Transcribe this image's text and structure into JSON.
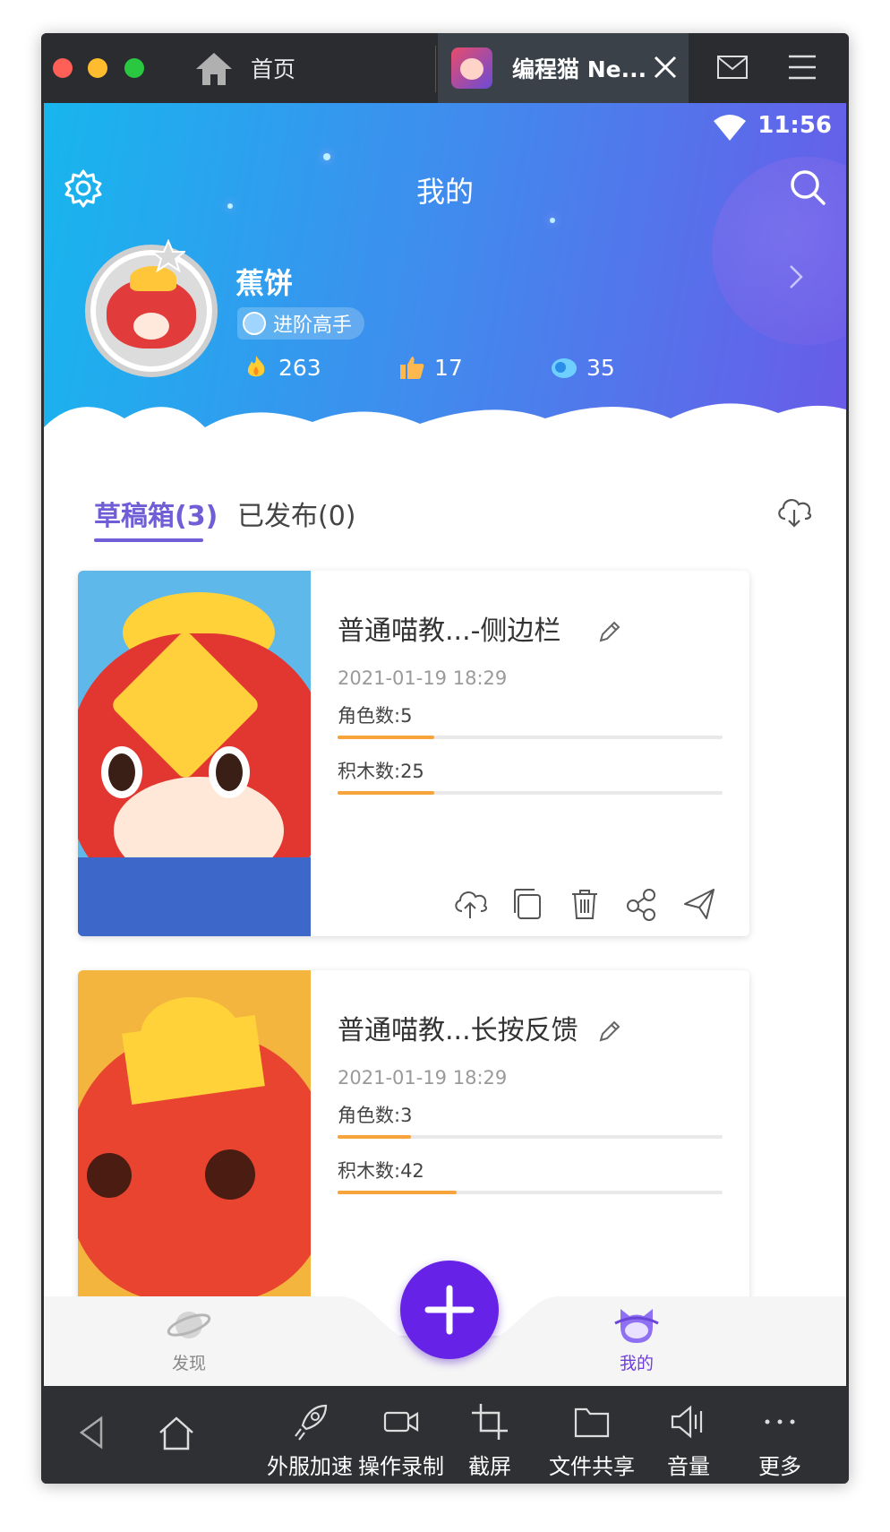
{
  "window": {
    "home_tab_label": "首页",
    "app_tab_label": "编程猫 Ne...",
    "icons": {
      "home": "house-icon",
      "close": "close-icon",
      "mail": "mail-icon",
      "menu": "hamburger-menu-icon"
    }
  },
  "status_bar": {
    "time": "11:56"
  },
  "header": {
    "title": "我的",
    "username": "蕉饼",
    "rank_badge": "进阶高手",
    "stats": [
      {
        "icon": "fire-icon",
        "value": "263"
      },
      {
        "icon": "thumbs-up-icon",
        "value": "17"
      },
      {
        "icon": "coin-icon",
        "value": "35"
      }
    ]
  },
  "tabs": {
    "drafts": "草稿箱(3)",
    "published": "已发布(0)",
    "active": "drafts"
  },
  "projects": [
    {
      "title": "普通喵教...-侧边栏",
      "date": "2021-01-19 18:29",
      "roles_label": "角色数:5",
      "roles_fill": 0.25,
      "blocks_label": "积木数:25",
      "blocks_fill": 0.25
    },
    {
      "title": "普通喵教...长按反馈",
      "date": "2021-01-19 18:29",
      "roles_label": "角色数:3",
      "roles_fill": 0.19,
      "blocks_label": "积木数:42",
      "blocks_fill": 0.31
    }
  ],
  "card_actions": [
    "upload-cloud-icon",
    "copy-icon",
    "trash-icon",
    "share-icon",
    "send-icon"
  ],
  "bottom_nav": {
    "discover": "发现",
    "mine": "我的",
    "active": "mine"
  },
  "toolbar": {
    "accelerate": "外服加速",
    "record": "操作录制",
    "screenshot": "截屏",
    "file_share": "文件共享",
    "volume": "音量",
    "more": "更多"
  },
  "colors": {
    "accent": "#6f5ed6",
    "fab": "#6722e8",
    "progress": "#f8a33b",
    "header_start": "#17b6ee",
    "header_end": "#6a5ae8"
  }
}
